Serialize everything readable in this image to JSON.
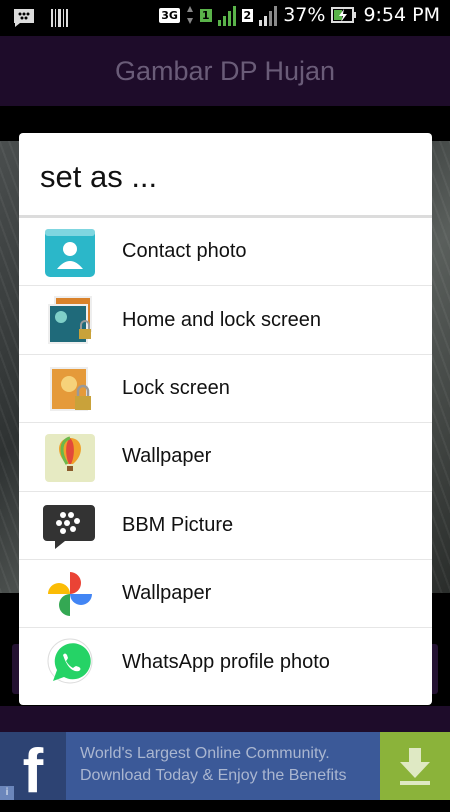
{
  "status_bar": {
    "network": "3G",
    "sim1": "1",
    "sim2": "2",
    "battery": "37%",
    "time": "9:54 PM"
  },
  "app_bar": {
    "title": "Gambar DP Hujan"
  },
  "dialog": {
    "title": "set as ...",
    "options": [
      {
        "label": "Contact photo",
        "icon": "contact-photo-icon"
      },
      {
        "label": "Home and lock screen",
        "icon": "home-lock-screen-icon"
      },
      {
        "label": "Lock screen",
        "icon": "lock-screen-icon"
      },
      {
        "label": "Wallpaper",
        "icon": "balloon-wallpaper-icon"
      },
      {
        "label": "BBM Picture",
        "icon": "bbm-icon"
      },
      {
        "label": "Wallpaper",
        "icon": "google-photos-pinwheel-icon"
      },
      {
        "label": "WhatsApp profile photo",
        "icon": "whatsapp-icon"
      }
    ]
  },
  "ad": {
    "logo": "f",
    "line1": "World's Largest Online Community.",
    "line2": "Download Today & Enjoy the Benefits"
  },
  "colors": {
    "app_bar": "#1e0c2a",
    "ad_background": "#3b5998",
    "download_button": "#8bb33a"
  }
}
